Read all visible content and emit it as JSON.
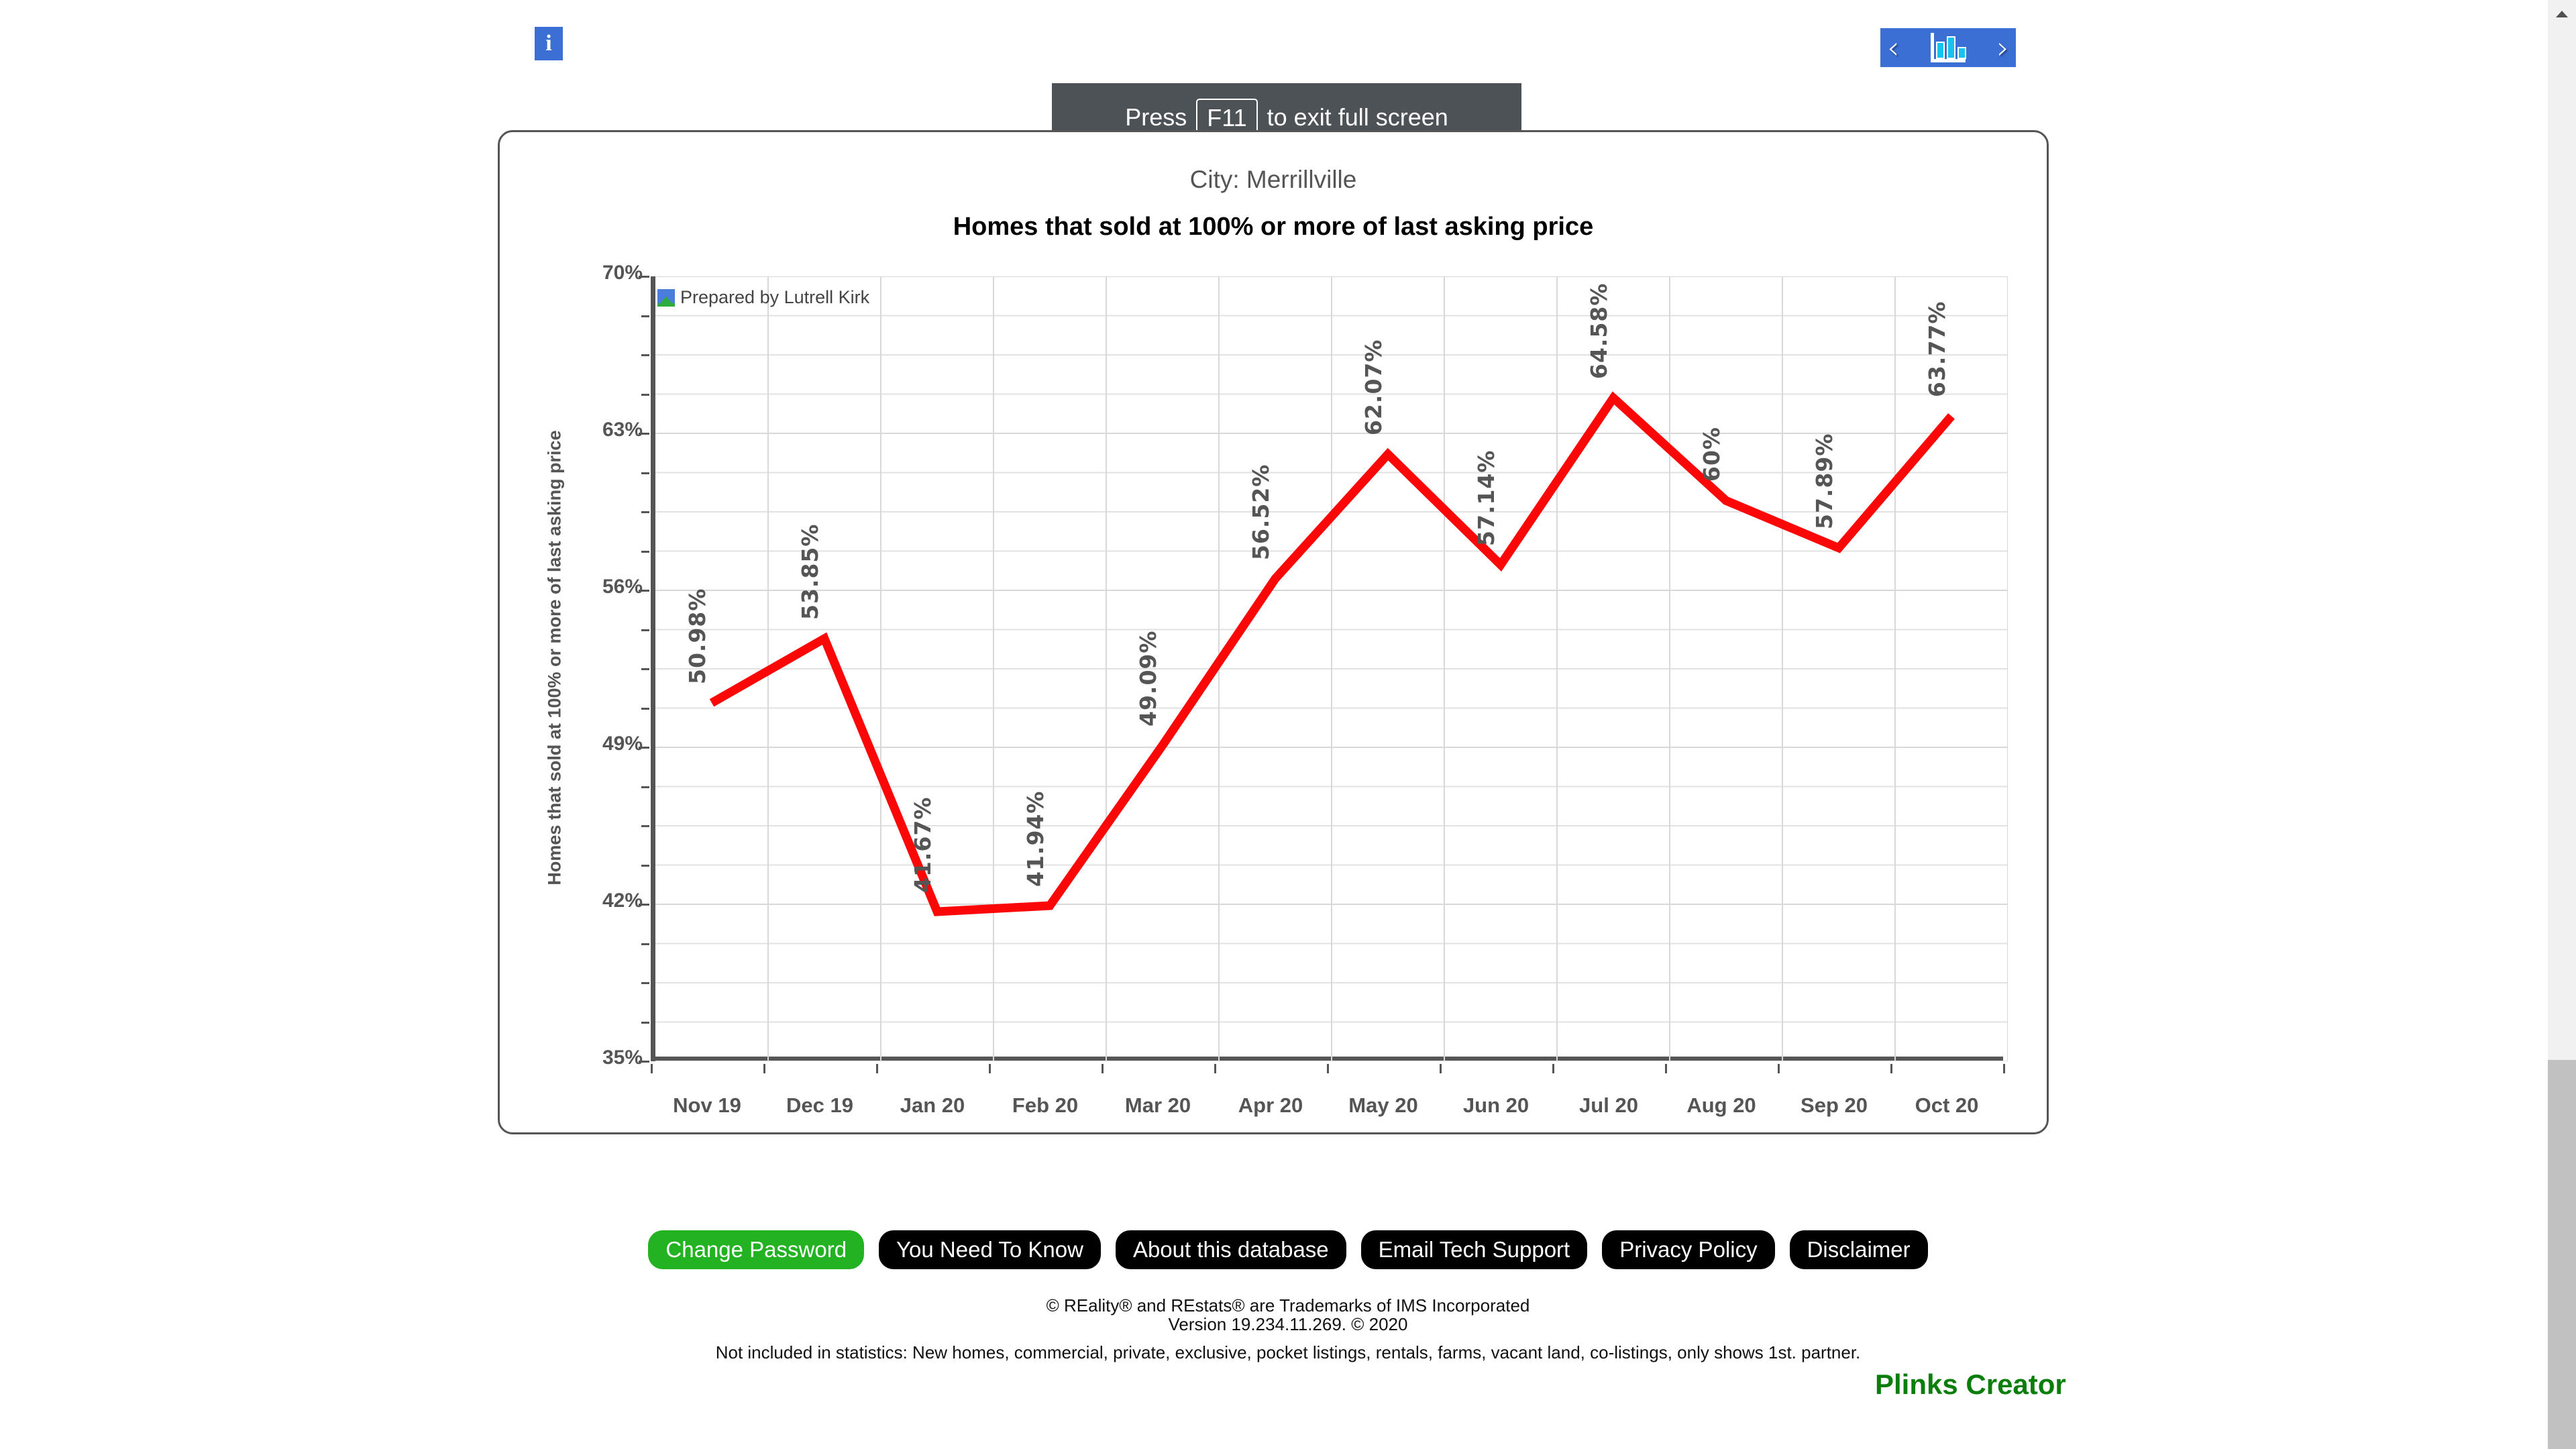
{
  "topbar": {
    "info_icon": "info-icon",
    "nav": {
      "prev_icon": "chevron-left-icon",
      "chart_icon": "bar-chart-icon",
      "next_icon": "chevron-right-icon"
    }
  },
  "fullscreen_toast": {
    "prefix": "Press",
    "key": "F11",
    "suffix": "to exit full screen"
  },
  "chart_card": {
    "city_line": "City: Merrillville",
    "title": "Homes that sold at 100% or more of last asking price",
    "prepared_by": "Prepared by Lutrell Kirk",
    "prepared_icon": "broken-image-icon"
  },
  "chart_data": {
    "type": "line",
    "title": "Homes that sold at 100% or more of last asking price",
    "subtitle": "City: Merrillville",
    "xlabel": "",
    "ylabel": "Homes that sold at 100% or more of last asking price",
    "categories": [
      "Nov 19",
      "Dec 19",
      "Jan 20",
      "Feb 20",
      "Mar 20",
      "Apr 20",
      "May 20",
      "Jun 20",
      "Jul 20",
      "Aug 20",
      "Sep 20",
      "Oct 20"
    ],
    "values": [
      50.98,
      53.85,
      41.67,
      41.94,
      49.09,
      56.52,
      62.07,
      57.14,
      64.58,
      60,
      57.89,
      63.77
    ],
    "data_labels": [
      "50.98%",
      "53.85%",
      "41.67%",
      "41.94%",
      "49.09%",
      "56.52%",
      "62.07%",
      "57.14%",
      "64.58%",
      "60%",
      "57.89%",
      "63.77%"
    ],
    "ylim": [
      35,
      70
    ],
    "yticks": [
      70,
      63,
      56,
      49,
      42,
      35
    ],
    "ytick_labels": [
      "70%",
      "63%",
      "56%",
      "49%",
      "42%",
      "35%"
    ],
    "grid": true,
    "legend": false,
    "series_color": "#fb0707",
    "axis_color": "#555555"
  },
  "footer": {
    "buttons": [
      {
        "label": "Change Password",
        "style": "green"
      },
      {
        "label": "You Need To Know",
        "style": "black"
      },
      {
        "label": "About this database",
        "style": "black"
      },
      {
        "label": "Email Tech Support",
        "style": "black"
      },
      {
        "label": "Privacy Policy",
        "style": "black"
      },
      {
        "label": "Disclaimer",
        "style": "black"
      }
    ],
    "legal_line1": "© REality® and REstats® are Trademarks of IMS Incorporated",
    "legal_line2": "Version 19.234.11.269. © 2020",
    "legal_line3": "Not included in statistics: New homes, commercial, private, exclusive, pocket listings, rentals, farms, vacant land, co-listings, only shows 1st. partner.",
    "brand": "Plinks Creator"
  },
  "scrollbar": {
    "up_icon": "scroll-up-arrow-icon",
    "thumb": "scrollbar-thumb"
  }
}
